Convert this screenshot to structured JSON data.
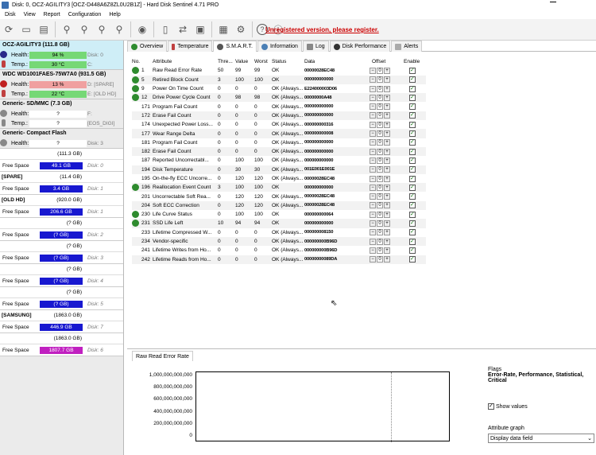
{
  "window": {
    "title": "Disk: 0, OCZ-AGILITY3 [OCZ-D448A6Z8ZL0U2B1Z] - Hard Disk Sentinel 4.71 PRO"
  },
  "menu": [
    "Disk",
    "View",
    "Report",
    "Configuration",
    "Help"
  ],
  "toolbar": {
    "unregistered": "Unregistered version, please register."
  },
  "disks": [
    {
      "name": "OCZ-AGILITY3 (111.8 GB)",
      "disk": "Disk: 0",
      "health": "94 %",
      "temp": "30 °C",
      "drive": "C:",
      "health_color": "#76d876",
      "temp_color": "#76d876",
      "selected": true
    },
    {
      "name": "WDC WD1001FAES-75W7A0 (931.5 GB)",
      "disk": "Disk: 1",
      "health": "13 %",
      "temp": "22 °C",
      "drive": "D: [SPARE]",
      "drive2": "E: [OLD HD]",
      "health_color": "#f0a0a0",
      "temp_color": "#76d876",
      "selected": false
    },
    {
      "name": "Generic- SD/MMC (7.3 GB)",
      "disk": "Disk: 2",
      "health": "?",
      "temp": "?",
      "drive": "F:",
      "drive2": "[EOS_DIGI]",
      "health_color": "#ffffff",
      "temp_color": "#ffffff",
      "selected": false
    },
    {
      "name": "Generic- Compact Flash",
      "disk": "Disk: 3",
      "health": "?",
      "temp": "",
      "drive": "",
      "health_color": "#ffffff",
      "temp_color": "#ffffff",
      "selected": false
    }
  ],
  "labels": {
    "health": "Health:",
    "temp": "Temp.:",
    "free_space": "Free Space"
  },
  "volumes": [
    {
      "name": "",
      "size": "(111.3 GB)",
      "free": "49.1 GB",
      "disk": "Disk: 0",
      "color": "#1818d0"
    },
    {
      "name": "[SPARE]",
      "size": "(11.4 GB)",
      "free": "3.4 GB",
      "disk": "Disk: 1",
      "color": "#1818d0"
    },
    {
      "name": "[OLD HD]",
      "size": "(920.0 GB)",
      "free": "206.6 GB",
      "disk": "Disk: 1",
      "color": "#1818d0"
    },
    {
      "name": "",
      "size": "(? GB)",
      "free": "(? GB)",
      "disk": "Disk: 2",
      "color": "#1818d0"
    },
    {
      "name": "",
      "size": "(? GB)",
      "free": "(? GB)",
      "disk": "Disk: 3",
      "color": "#1818d0"
    },
    {
      "name": "",
      "size": "(? GB)",
      "free": "(? GB)",
      "disk": "Disk: 4",
      "color": "#1818d0"
    },
    {
      "name": "",
      "size": "(? GB)",
      "free": "(? GB)",
      "disk": "Disk: 5",
      "color": "#1818d0"
    },
    {
      "name": "[SAMSUNG]",
      "size": "(1863.0 GB)",
      "free": "446.9 GB",
      "disk": "Disk: 7",
      "color": "#1818d0"
    },
    {
      "name": "",
      "size": "(1863.0 GB)",
      "free": "1807.7 GB",
      "disk": "Disk: 6",
      "color": "#c020c0"
    }
  ],
  "tabs": [
    "Overview",
    "Temperature",
    "S.M.A.R.T.",
    "Information",
    "Log",
    "Disk Performance",
    "Alerts"
  ],
  "smart_headers": {
    "no": "No.",
    "attr": "Attribute",
    "thr": "Thre...",
    "val": "Value",
    "worst": "Worst",
    "status": "Status",
    "data": "Data",
    "offset": "Offset",
    "enable": "Enable"
  },
  "smart_rows": [
    {
      "ok": true,
      "no": "1",
      "attr": "Raw Read Error Rate",
      "thr": "50",
      "val": "99",
      "worst": "99",
      "status": "OK",
      "data": "00000028EC48"
    },
    {
      "ok": true,
      "no": "5",
      "attr": "Retired Block Count",
      "thr": "3",
      "val": "100",
      "worst": "100",
      "status": "OK",
      "data": "000000000000"
    },
    {
      "ok": true,
      "no": "9",
      "attr": "Power On Time Count",
      "thr": "0",
      "val": "0",
      "worst": "0",
      "status": "OK (Always...",
      "data": "E224000003D06"
    },
    {
      "ok": true,
      "no": "12",
      "attr": "Drive Power Cycle Count",
      "thr": "0",
      "val": "98",
      "worst": "98",
      "status": "OK (Always...",
      "data": "00000000A48"
    },
    {
      "ok": false,
      "no": "171",
      "attr": "Program Fail Count",
      "thr": "0",
      "val": "0",
      "worst": "0",
      "status": "OK (Always...",
      "data": "000000000000"
    },
    {
      "ok": false,
      "no": "172",
      "attr": "Erase Fail Count",
      "thr": "0",
      "val": "0",
      "worst": "0",
      "status": "OK (Always...",
      "data": "000000000000"
    },
    {
      "ok": false,
      "no": "174",
      "attr": "Unexpected Power Loss...",
      "thr": "0",
      "val": "0",
      "worst": "0",
      "status": "OK (Always...",
      "data": "000000000316"
    },
    {
      "ok": false,
      "no": "177",
      "attr": "Wear Range Delta",
      "thr": "0",
      "val": "0",
      "worst": "0",
      "status": "OK (Always...",
      "data": "000000000008"
    },
    {
      "ok": false,
      "no": "181",
      "attr": "Program Fail Count",
      "thr": "0",
      "val": "0",
      "worst": "0",
      "status": "OK (Always...",
      "data": "000000000000"
    },
    {
      "ok": false,
      "no": "182",
      "attr": "Erase Fail Count",
      "thr": "0",
      "val": "0",
      "worst": "0",
      "status": "OK (Always...",
      "data": "000000000000"
    },
    {
      "ok": false,
      "no": "187",
      "attr": "Reported Uncorrectabl...",
      "thr": "0",
      "val": "100",
      "worst": "100",
      "status": "OK (Always...",
      "data": "000000000000"
    },
    {
      "ok": false,
      "no": "194",
      "attr": "Disk Temperature",
      "thr": "0",
      "val": "30",
      "worst": "30",
      "status": "OK (Always...",
      "data": "001E001E001E"
    },
    {
      "ok": false,
      "no": "195",
      "attr": "On-the-fly ECC Uncorre...",
      "thr": "0",
      "val": "120",
      "worst": "120",
      "status": "OK (Always...",
      "data": "00000028EC48"
    },
    {
      "ok": true,
      "no": "196",
      "attr": "Reallocation Event Count",
      "thr": "3",
      "val": "100",
      "worst": "100",
      "status": "OK",
      "data": "000000000000"
    },
    {
      "ok": false,
      "no": "201",
      "attr": "Uncorrectable Soft Rea...",
      "thr": "0",
      "val": "120",
      "worst": "120",
      "status": "OK (Always...",
      "data": "00000028EC48"
    },
    {
      "ok": false,
      "no": "204",
      "attr": "Soft ECC Correction",
      "thr": "0",
      "val": "120",
      "worst": "120",
      "status": "OK (Always...",
      "data": "00000028EC48"
    },
    {
      "ok": true,
      "no": "230",
      "attr": "Life Curve Status",
      "thr": "0",
      "val": "100",
      "worst": "100",
      "status": "OK",
      "data": "000000000064"
    },
    {
      "ok": true,
      "no": "231",
      "attr": "SSD Life Left",
      "thr": "10",
      "val": "94",
      "worst": "94",
      "status": "OK",
      "data": "000000000000"
    },
    {
      "ok": false,
      "no": "233",
      "attr": "Lifetime Compressed W...",
      "thr": "0",
      "val": "0",
      "worst": "0",
      "status": "OK (Always...",
      "data": "000000008150"
    },
    {
      "ok": false,
      "no": "234",
      "attr": "Vendor-specific",
      "thr": "0",
      "val": "0",
      "worst": "0",
      "status": "OK (Always...",
      "data": "000000000B96D"
    },
    {
      "ok": false,
      "no": "241",
      "attr": "Lifetime Writes from Ho...",
      "thr": "0",
      "val": "0",
      "worst": "0",
      "status": "OK (Always...",
      "data": "000000000B96D"
    },
    {
      "ok": false,
      "no": "242",
      "attr": "Lifetime Reads from Ho...",
      "thr": "0",
      "val": "0",
      "worst": "0",
      "status": "OK (Always...",
      "data": "00000000089DA"
    }
  ],
  "offset_value": "0",
  "lower": {
    "tab": "Raw Read Error Rate",
    "ylabels": [
      "1,000,000,000,000",
      "800,000,000,000",
      "600,000,000,000",
      "400,000,000,000",
      "200,000,000,000",
      "0"
    ],
    "flags_label": "Flags",
    "flags_value": "Error-Rate, Performance, Statistical, Critical",
    "show_values": "Show values",
    "attribute_graph": "Attribute graph",
    "display_field": "Display data field"
  }
}
